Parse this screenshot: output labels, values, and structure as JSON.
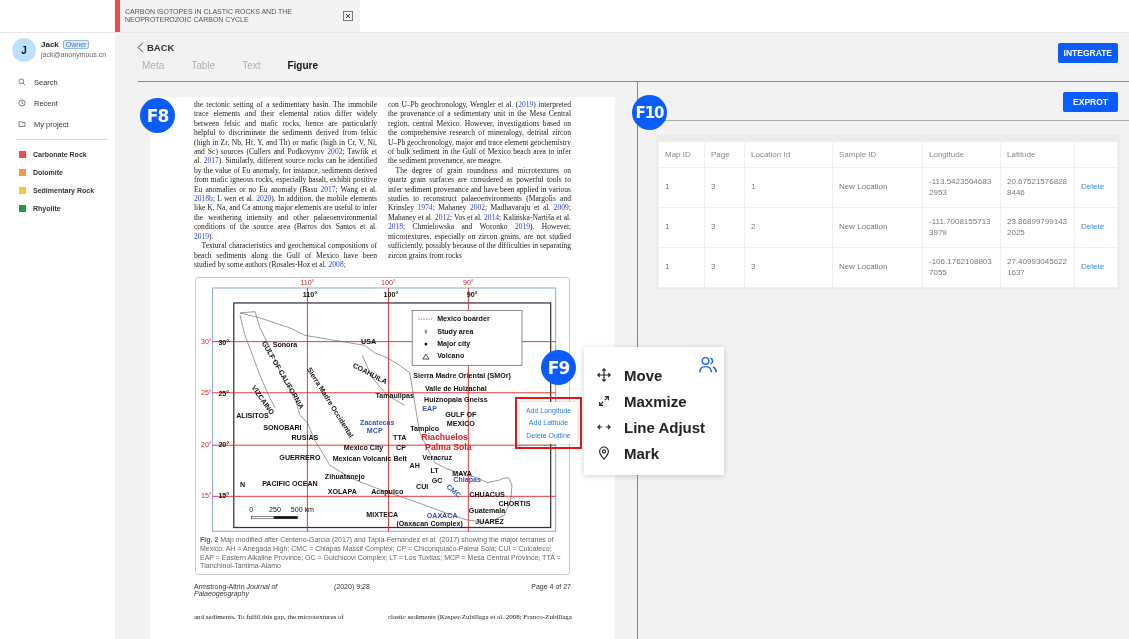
{
  "top_tab": {
    "title": "CARBON ISOTOPES IN CLASTIC ROCKS AND THE NEOPROTEROZOIC CARBON CYCLE"
  },
  "user": {
    "initial": "J",
    "name": "Jack",
    "role": "Owner",
    "email": "jack@anonymous.cn"
  },
  "nav": [
    {
      "kind": "search",
      "label": "Search"
    },
    {
      "kind": "recent",
      "label": "Recent"
    },
    {
      "kind": "folder",
      "label": "My project"
    }
  ],
  "tags": [
    {
      "label": "Carbonate Rock",
      "color": "#e84d4d"
    },
    {
      "label": "Dolomite",
      "color": "#f39a4a"
    },
    {
      "label": "Sedimentary Rock",
      "color": "#f5c542"
    },
    {
      "label": "Rhyolite",
      "color": "#1f9a4a"
    }
  ],
  "back": "BACK",
  "tabs": [
    {
      "label": "Meta",
      "selected": false
    },
    {
      "label": "Table",
      "selected": false
    },
    {
      "label": "Text",
      "selected": false
    },
    {
      "label": "Figure",
      "selected": true
    }
  ],
  "integrate_button": "INTEGRATE",
  "document": {
    "marker": "F8",
    "columns": [
      [
        {
          "indent": false,
          "segments": [
            {
              "kind": "text",
              "text": "the tectonic setting of a sedimentary basin. The immobile trace elements and their elemental ratios differ widely between felsic and mafic rocks, hence are particularly helpful to discriminate the sediments derived from felsic (high in Zr, Nb, Hf, Y, and Th) or mafic (high in Cr, V, Ni, and Sc) sources (Cullers and Podkovyrov "
            },
            {
              "kind": "link",
              "text": "2002"
            },
            {
              "kind": "text",
              "text": "; Tawfik et al. "
            },
            {
              "kind": "link",
              "text": "2017"
            },
            {
              "kind": "text",
              "text": "). Similarly, different source rocks can be identified by the value of Eu anomaly, for instance, sediments derived from mafic igneous rocks, especially basalt, exhibit positive Eu anomalies or no Eu anomaly (Basu "
            },
            {
              "kind": "link",
              "text": "2017"
            },
            {
              "kind": "text",
              "text": "; Wang et al. "
            },
            {
              "kind": "link",
              "text": "2018b"
            },
            {
              "kind": "text",
              "text": "; L wen et al. "
            },
            {
              "kind": "link",
              "text": "2020"
            },
            {
              "kind": "text",
              "text": "). In addition, the mobile elements like K, Na, and Ca among major elements are useful to infer the weathering intensity and other palaeoenvironmental conditions of the source area (Barros dos Santos et al. "
            },
            {
              "kind": "link",
              "text": "2019"
            },
            {
              "kind": "text",
              "text": ")."
            }
          ]
        },
        {
          "indent": true,
          "segments": [
            {
              "kind": "text",
              "text": "Textural characteristics and geochemical compositions of beach sediments along the Gulf of Mexico have been studied by some authors (Rosales-Hoz et al. "
            },
            {
              "kind": "link",
              "text": "2008"
            },
            {
              "kind": "text",
              "text": ";"
            }
          ]
        }
      ],
      [
        {
          "indent": false,
          "segments": [
            {
              "kind": "text",
              "text": "con U–Pb geochronology, Wengler et al. ("
            },
            {
              "kind": "link",
              "text": "2019"
            },
            {
              "kind": "text",
              "text": ") interpreted the provenance of a sedimentary unit in the Mesa Central region, central Mexico. However, investigations based on the comprehensive research of mineralogy, detrital zircon U–Pb geochronology, major and trace element geochemistry of bulk sediment in the Gulf of Mexico beach area to infer the sediment provenance, are meagre."
            }
          ]
        },
        {
          "indent": true,
          "segments": [
            {
              "kind": "text",
              "text": "The degree of grain roundness and microtextures on quartz grain surfaces are considered as powerful tools to infer sediment provenance and have been applied in various studies to reconstruct palaeoenvironments (Margolis and Krinsley "
            },
            {
              "kind": "link",
              "text": "1974"
            },
            {
              "kind": "text",
              "text": "; Mahaney "
            },
            {
              "kind": "link",
              "text": "2002"
            },
            {
              "kind": "text",
              "text": "; Madhavaraju et al. "
            },
            {
              "kind": "link",
              "text": "2009"
            },
            {
              "kind": "text",
              "text": "; Mahaney et al. "
            },
            {
              "kind": "link",
              "text": "2012"
            },
            {
              "kind": "text",
              "text": "; Vos et al. "
            },
            {
              "kind": "link",
              "text": "2014"
            },
            {
              "kind": "text",
              "text": "; Kalińska-Nartiša et al. "
            },
            {
              "kind": "link",
              "text": "2018"
            },
            {
              "kind": "text",
              "text": "; Chmielowska and Woronko "
            },
            {
              "kind": "link",
              "text": "2019"
            },
            {
              "kind": "text",
              "text": "). However, microtextures, especially on zircon grains, are not studied sufficiently, possibly because of the difficulties in separating zircon grains from rocks"
            }
          ]
        }
      ]
    ],
    "figure": {
      "grid_top": [
        "110°",
        "100°",
        "90°"
      ],
      "grid_left": [
        "30°",
        "25°",
        "20°",
        "15°"
      ],
      "frame_top": [
        "110°",
        "100°",
        "90°"
      ],
      "frame_left": [
        "30°",
        "25°",
        "20°",
        "15°"
      ],
      "legend": [
        {
          "kind": "boundary",
          "label": "Mexico boarder"
        },
        {
          "kind": "study",
          "label": "Study area"
        },
        {
          "kind": "city",
          "label": "Major city"
        },
        {
          "kind": "volcano",
          "label": "Volcano"
        }
      ],
      "labels": [
        {
          "text": "USA",
          "kind": "place"
        },
        {
          "text": "Sonora",
          "kind": "place"
        },
        {
          "text": "GULF OF CALIFORNIA",
          "kind": "place"
        },
        {
          "text": "VIZCAINO",
          "kind": "place"
        },
        {
          "text": "Sierra Madre Occidental",
          "kind": "place"
        },
        {
          "text": "COAHUILA",
          "kind": "place"
        },
        {
          "text": "Sierra Madre Oriental (SMOr)",
          "kind": "place"
        },
        {
          "text": "Valle de Huizachal",
          "kind": "place"
        },
        {
          "text": "Tamaulipas",
          "kind": "place"
        },
        {
          "text": "Huiznopala Gneiss",
          "kind": "place"
        },
        {
          "text": "EAP",
          "kind": "province"
        },
        {
          "text": "GULF OF",
          "kind": "place"
        },
        {
          "text": "MEXICO",
          "kind": "place"
        },
        {
          "text": "Zacatecas",
          "kind": "province"
        },
        {
          "text": "MCP",
          "kind": "province"
        },
        {
          "text": "Tampico",
          "kind": "place"
        },
        {
          "text": "TTA",
          "kind": "place"
        },
        {
          "text": "Riachuelos",
          "kind": "study"
        },
        {
          "text": "Palma Sola",
          "kind": "study"
        },
        {
          "text": "ALISITOS",
          "kind": "place"
        },
        {
          "text": "SONOBARI",
          "kind": "place"
        },
        {
          "text": "RUSIAS",
          "kind": "place"
        },
        {
          "text": "Mexico City",
          "kind": "place"
        },
        {
          "text": "CP",
          "kind": "place"
        },
        {
          "text": "GUERRERO",
          "kind": "place"
        },
        {
          "text": "Mexican Volcanic Belt",
          "kind": "place"
        },
        {
          "text": "Veracruz",
          "kind": "place"
        },
        {
          "text": "AH",
          "kind": "place"
        },
        {
          "text": "LT",
          "kind": "place"
        },
        {
          "text": "MAYA",
          "kind": "place"
        },
        {
          "text": "GC",
          "kind": "place"
        },
        {
          "text": "Chiapas",
          "kind": "province"
        },
        {
          "text": "CMC",
          "kind": "province"
        },
        {
          "text": "CUI",
          "kind": "place"
        },
        {
          "text": "N",
          "kind": "place"
        },
        {
          "text": "PACIFIC OCEAN",
          "kind": "place"
        },
        {
          "text": "Zihuatanejo",
          "kind": "place"
        },
        {
          "text": "XOLAPA",
          "kind": "place"
        },
        {
          "text": "Acapulco",
          "kind": "place"
        },
        {
          "text": "CHUACUS",
          "kind": "place"
        },
        {
          "text": "CHORTIS",
          "kind": "place"
        },
        {
          "text": "Guatemala",
          "kind": "place"
        },
        {
          "text": "MIXTECA",
          "kind": "place"
        },
        {
          "text": "OAXACA",
          "kind": "province"
        },
        {
          "text": "(Oaxacan Complex)",
          "kind": "place"
        },
        {
          "text": "JUAREZ",
          "kind": "place"
        }
      ],
      "scale_labels": [
        "0",
        "250",
        "500 km"
      ],
      "caption": "**Fig. 2** Map modified after Centeno-García (2017) and Tapia-Fernandez et al. (2017) showing the major terranes of Mexico. AH = Anegada High; CMC = Chiapas Massif Complex; CP = Chiconquiaco-Palma Sola; CUI = Cuicateco; EAP = Eastern Alkaline Province; GC = Guichicovi Complex; LT = Los Tuxtlas; MCP = Mesa Central Province; TTA = Tlanchinol-Tantima-Alamo"
    },
    "footer": {
      "journal": "Armstrong-Altrin *Journal of Palaeogeography*",
      "issue": "(2020) 9:28",
      "page": "Page 4 of 27"
    },
    "next_page_lines": [
      "and sediments. To fulfil this gap, the microtextures of",
      "clastic sediments (Kasper-Zubillaga et al. 2008; Franco-Zubillaga"
    ]
  },
  "context_menu": {
    "marker": "F9",
    "items": [
      "Add Longitude",
      "Add Latitude",
      "Delete Outline"
    ]
  },
  "tools": [
    {
      "kind": "move",
      "label": "Move"
    },
    {
      "kind": "maximize",
      "label": "Maxmize"
    },
    {
      "kind": "line",
      "label": "Line Adjust"
    },
    {
      "kind": "mark",
      "label": "Mark"
    }
  ],
  "export_button": "EXPROT",
  "results": {
    "marker": "F10",
    "columns": [
      "Map ID",
      "Page",
      "Location Id",
      "Sample ID",
      "Longitude",
      "Latitude"
    ],
    "rows": [
      {
        "cells": [
          "1",
          "3",
          "1",
          "New Location",
          "-113.54235046832953",
          "20.675215768288446"
        ],
        "action": "Delete"
      },
      {
        "cells": [
          "1",
          "3",
          "2",
          "New Location",
          "-111.70081557133979",
          "23.868997991432025"
        ],
        "action": "Delete"
      },
      {
        "cells": [
          "1",
          "3",
          "3",
          "New Location",
          "-106.17621088037055",
          "27.409930456221637"
        ],
        "action": "Delete"
      }
    ]
  }
}
